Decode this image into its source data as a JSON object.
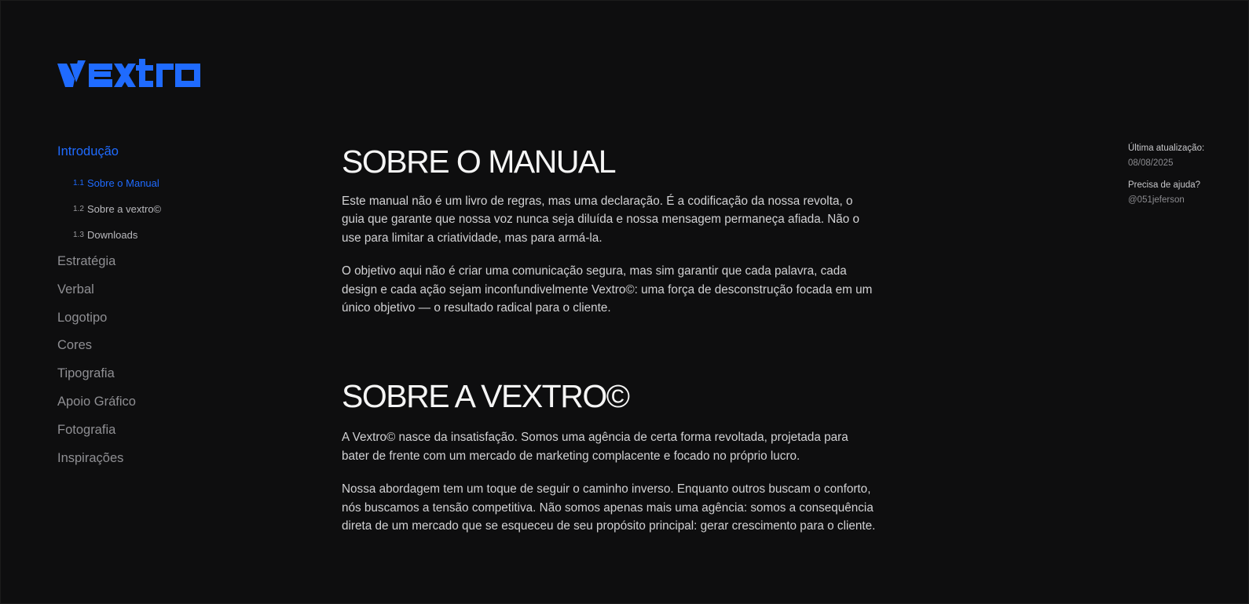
{
  "brand": {
    "logo_text": "vextro",
    "accent_color": "#1f6bff",
    "background_color": "#0e0e0f"
  },
  "sidebar": {
    "top_item": {
      "label": "Introdução",
      "active": true
    },
    "sub_items": [
      {
        "num": "1.1",
        "label": "Sobre o Manual",
        "active": true
      },
      {
        "num": "1.2",
        "label": "Sobre a vextro©",
        "active": false
      },
      {
        "num": "1.3",
        "label": "Downloads",
        "active": false
      }
    ],
    "items": [
      {
        "label": "Estratégia"
      },
      {
        "label": "Verbal"
      },
      {
        "label": "Logotipo"
      },
      {
        "label": "Cores"
      },
      {
        "label": "Tipografia"
      },
      {
        "label": "Apoio Gráfico"
      },
      {
        "label": "Fotografia"
      },
      {
        "label": "Inspirações"
      }
    ]
  },
  "main": {
    "sections": [
      {
        "title": "SOBRE O MANUAL",
        "paragraphs": [
          "Este manual não é um livro de regras, mas uma declaração. É a codificação da nossa revolta, o guia que garante que nossa voz nunca seja diluída e nossa mensagem permaneça afiada. Não o use para limitar a criatividade, mas para armá-la.",
          "O objetivo aqui não é criar uma comunicação segura, mas sim garantir que cada palavra, cada design e cada ação sejam inconfundivelmente Vextro©: uma força de desconstrução focada em um único objetivo — o resultado radical para o cliente."
        ]
      },
      {
        "title": "SOBRE A VEXTRO©",
        "paragraphs": [
          "A Vextro© nasce da insatisfação. Somos uma agência de certa forma revoltada, projetada para bater de frente com um mercado de marketing complacente e focado no próprio lucro.",
          "Nossa abordagem tem um toque de seguir o caminho inverso. Enquanto outros buscam o conforto, nós buscamos a tensão competitiva. Não somos apenas mais uma agência: somos a consequência direta de um mercado que se esqueceu de seu propósito principal: gerar crescimento para o cliente."
        ]
      }
    ]
  },
  "meta": {
    "updated_label": "Última atualização:",
    "updated_value": "08/08/2025",
    "help_label": "Precisa de ajuda?",
    "help_value": "@051jeferson"
  }
}
